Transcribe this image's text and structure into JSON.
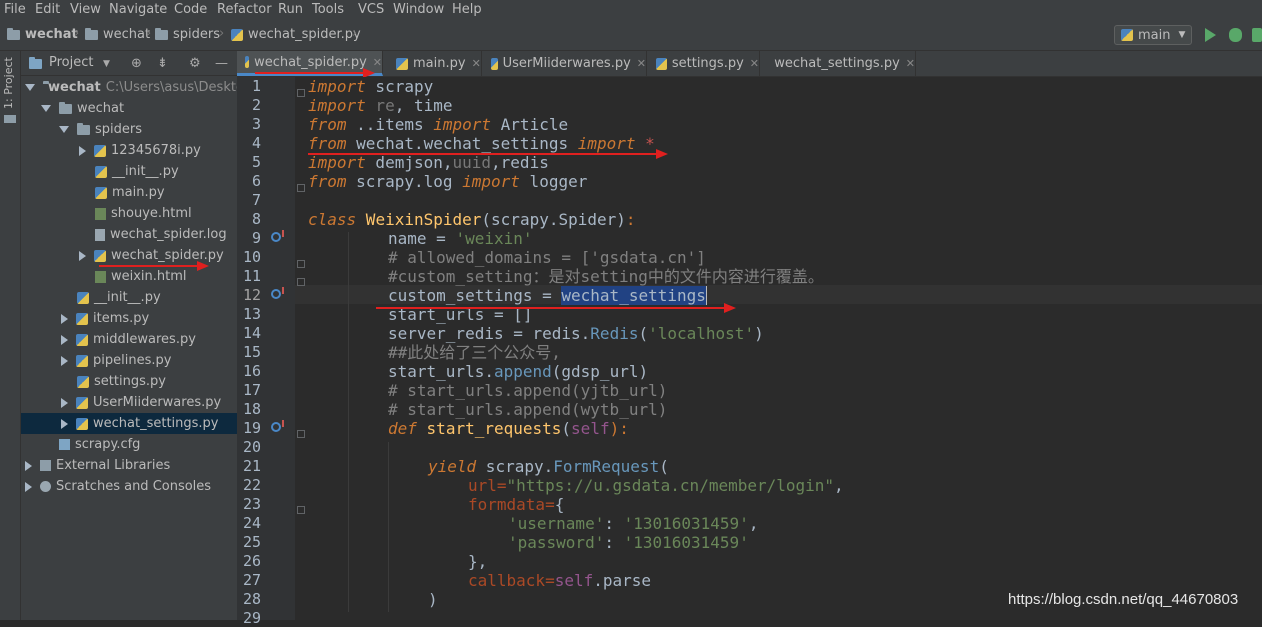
{
  "menu": [
    "File",
    "Edit",
    "View",
    "Navigate",
    "Code",
    "Refactor",
    "Run",
    "Tools",
    "VCS",
    "Window",
    "Help"
  ],
  "breadcrumbs": [
    "wechat",
    "wechat",
    "spiders",
    "wechat_spider.py"
  ],
  "run_config": "main",
  "toolstrip_label": "1: Project",
  "sidebar": {
    "title": "Project",
    "tree": [
      {
        "label": "wechat",
        "path": "C:\\Users\\asus\\Desktop"
      },
      {
        "label": "wechat"
      },
      {
        "label": "spiders"
      },
      {
        "label": "12345678i.py"
      },
      {
        "label": "__init__.py"
      },
      {
        "label": "main.py"
      },
      {
        "label": "shouye.html"
      },
      {
        "label": "wechat_spider.log"
      },
      {
        "label": "wechat_spider.py"
      },
      {
        "label": "weixin.html"
      },
      {
        "label": "__init__.py"
      },
      {
        "label": "items.py"
      },
      {
        "label": "middlewares.py"
      },
      {
        "label": "pipelines.py"
      },
      {
        "label": "settings.py"
      },
      {
        "label": "UserMiiderwares.py"
      },
      {
        "label": "wechat_settings.py"
      },
      {
        "label": "scrapy.cfg"
      },
      {
        "label": "External Libraries"
      },
      {
        "label": "Scratches and Consoles"
      }
    ]
  },
  "tabs": [
    "wechat_spider.py",
    "main.py",
    "UserMiiderwares.py",
    "settings.py",
    "wechat_settings.py"
  ],
  "code": {
    "l1": [
      "import",
      " scrapy"
    ],
    "l2": [
      "import",
      " re",
      ", time"
    ],
    "l3": [
      "from",
      " ..items ",
      "import",
      " Article"
    ],
    "l4": [
      "from",
      " wechat.wechat_settings ",
      "import",
      " *"
    ],
    "l5": [
      "import",
      " demjson,",
      "uuid",
      ",redis"
    ],
    "l6": [
      "from",
      " scrapy.log ",
      "import",
      " logger"
    ],
    "l8": [
      "class",
      " WeixinSpider",
      "(scrapy.Spider)",
      ":"
    ],
    "l9": [
      "name = ",
      "'weixin'"
    ],
    "l10": "# allowed_domains = ['gsdata.cn']",
    "l11": "#custom_setting：是对setting中的文件内容进行覆盖。",
    "l12": [
      "custom_settings = ",
      "wechat_settings"
    ],
    "l13": "start_urls = []",
    "l14": [
      "server_redis = redis.",
      "Redis",
      "(",
      "'localhost'",
      ")"
    ],
    "l15": "##此处给了三个公众号,",
    "l16": [
      "start_urls.",
      "append",
      "(gdsp_url)"
    ],
    "l17": "# start_urls.append(yjtb_url)",
    "l18": "# start_urls.append(wytb_url)",
    "l19": [
      "def",
      " ",
      "start_requests",
      "(",
      "self",
      "):"
    ],
    "l21": [
      "yield",
      " scrapy.",
      "FormRequest",
      "("
    ],
    "l22": [
      "url=",
      "\"https://u.gsdata.cn/member/login\"",
      ","
    ],
    "l23": [
      "formdata=",
      "{"
    ],
    "l24": [
      "'username'",
      ": ",
      "'13016031459'",
      ","
    ],
    "l25": [
      "'password'",
      ": ",
      "'13016031459'"
    ],
    "l26": "},",
    "l27": [
      "callback=",
      "self",
      ".parse"
    ],
    "l28": ")"
  },
  "watermark": "https://blog.csdn.net/qq_44670803",
  "colors": {
    "keyword": "#cc7832",
    "string": "#6a8759",
    "comment": "#808080",
    "annotation_arrow": "#e0201f"
  }
}
